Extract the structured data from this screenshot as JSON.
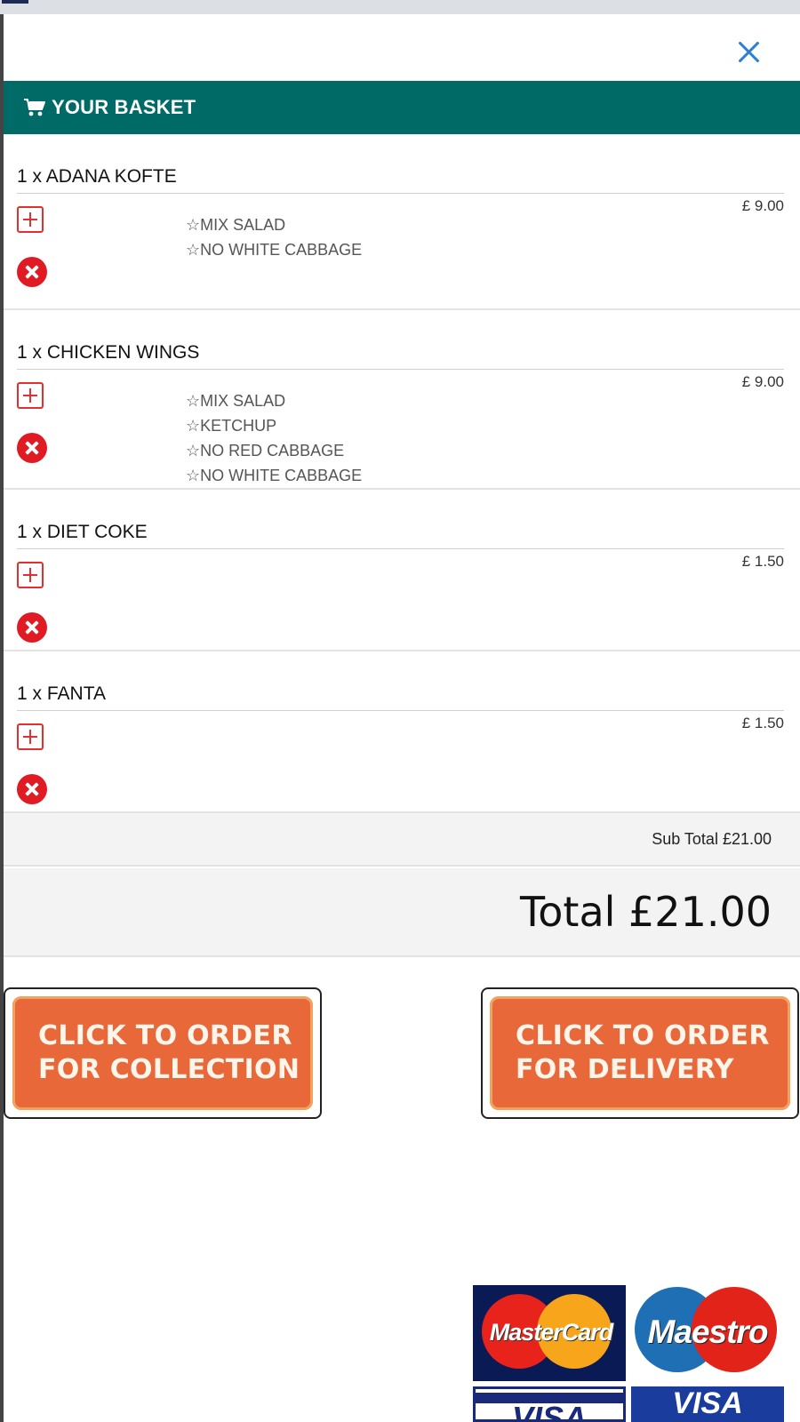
{
  "basket": {
    "title": "YOUR BASKET",
    "close_icon": "close-icon",
    "items": [
      {
        "name": "1 x ADANA KOFTE",
        "price": "£ 9.00",
        "options": [
          "☆MIX SALAD",
          "☆NO WHITE CABBAGE"
        ]
      },
      {
        "name": "1 x CHICKEN WINGS",
        "price": "£ 9.00",
        "options": [
          "☆MIX SALAD",
          "☆KETCHUP",
          "☆NO RED CABBAGE",
          "☆NO WHITE CABBAGE"
        ]
      },
      {
        "name": "1 x DIET COKE",
        "price": "£ 1.50",
        "options": []
      },
      {
        "name": "1 x FANTA",
        "price": "£ 1.50",
        "options": []
      }
    ],
    "subtotal": "Sub Total £21.00",
    "total": "Total £21.00"
  },
  "actions": {
    "collection_label": "CLICK TO ORDER\nFOR COLLECTION",
    "delivery_label": "CLICK TO ORDER\nFOR DELIVERY"
  },
  "payment": {
    "mastercard": "MasterCard",
    "maestro": "Maestro",
    "visa": "VISA",
    "visa_electron": "VISA"
  },
  "colors": {
    "header_bg": "#006a66",
    "button_orange": "#e8683a",
    "remove_red": "#e01b24",
    "close_blue": "#2d7fd0"
  }
}
